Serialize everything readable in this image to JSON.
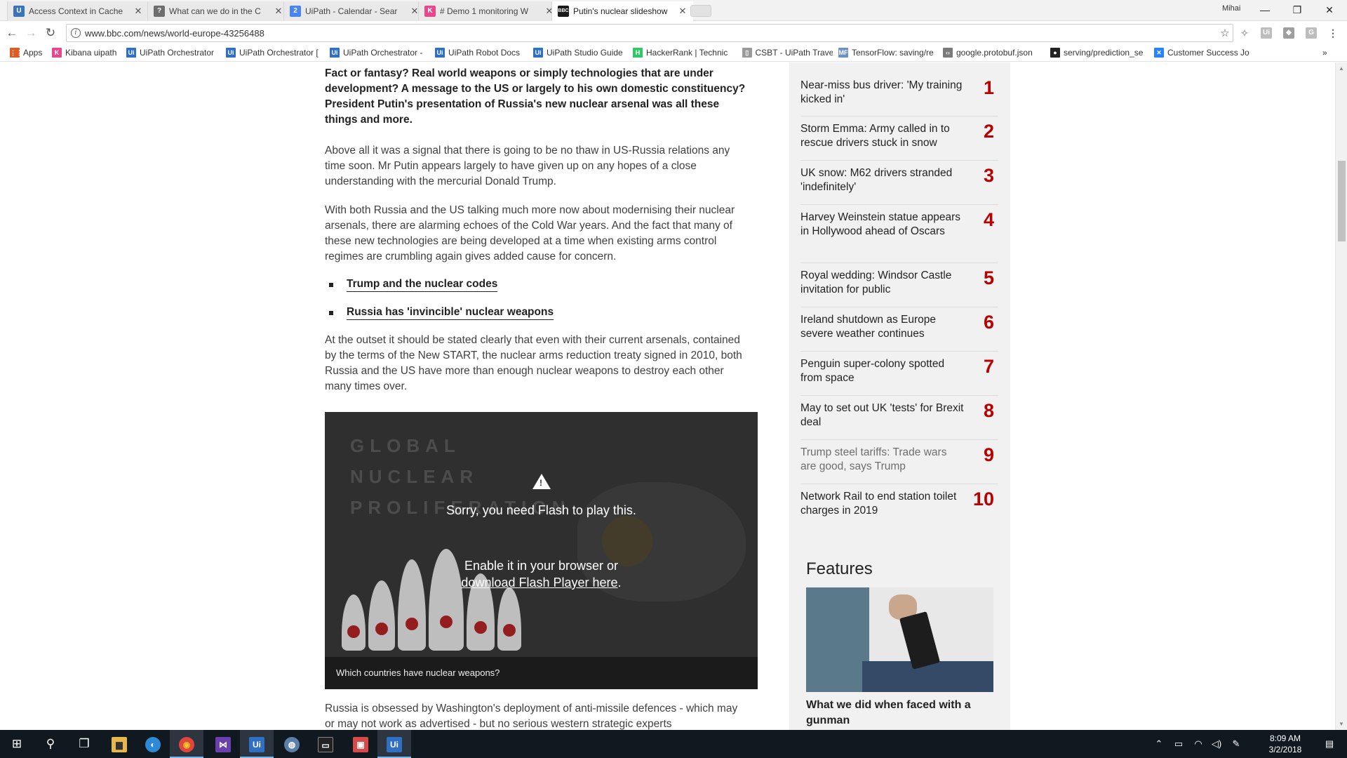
{
  "browser": {
    "tabs": [
      {
        "title": "Access Context in Cache",
        "icon": "uipath-icon",
        "color": "#3b73b9",
        "glyph": "U"
      },
      {
        "title": "What can we do in the C",
        "icon": "forum-icon",
        "color": "#6d6d6d",
        "glyph": "?"
      },
      {
        "title": "UiPath - Calendar - Sear",
        "icon": "calendar-icon",
        "color": "#4a84f0",
        "glyph": "2"
      },
      {
        "title": "# Demo 1 monitoring W",
        "icon": "kibana-icon",
        "color": "#e8488b",
        "glyph": "K"
      },
      {
        "title": "Putin's nuclear slideshow",
        "icon": "bbc-icon",
        "color": "#1a1a1a",
        "glyph": "B"
      }
    ],
    "window_user": "Mihai",
    "url": "www.bbc.com/news/world-europe-43256488",
    "bookmarks": [
      {
        "label": "Apps",
        "icon": "apps-grid-icon",
        "color": "#e05a24",
        "glyph": "⋮⋮"
      },
      {
        "label": "Kibana uipath",
        "icon": "kibana-icon",
        "color": "#e8488b",
        "glyph": "K"
      },
      {
        "label": "UiPath Orchestrator",
        "icon": "uipath-icon",
        "color": "#2f6fc4",
        "glyph": "Ui"
      },
      {
        "label": "UiPath Orchestrator [",
        "icon": "uipath-icon",
        "color": "#2f6fc4",
        "glyph": "Ui"
      },
      {
        "label": "UiPath Orchestrator -",
        "icon": "uipath-icon",
        "color": "#2f6fc4",
        "glyph": "Ui"
      },
      {
        "label": "UiPath Robot Docs",
        "icon": "uipath-icon",
        "color": "#2f6fc4",
        "glyph": "Ui"
      },
      {
        "label": "UiPath Studio Guide",
        "icon": "uipath-icon",
        "color": "#2f6fc4",
        "glyph": "Ui"
      },
      {
        "label": "HackerRank | Technic",
        "icon": "hackerrank-icon",
        "color": "#2ec866",
        "glyph": "H"
      },
      {
        "label": "CSBT - UiPath Travel",
        "icon": "page-icon",
        "color": "#9a9a9a",
        "glyph": "▯"
      },
      {
        "label": "TensorFlow: saving/re",
        "icon": "tensorflow-icon",
        "color": "#6b8fc9",
        "glyph": "MF"
      },
      {
        "label": "google.protobuf.json",
        "icon": "code-icon",
        "color": "#7a7a7a",
        "glyph": "‹›"
      },
      {
        "label": "serving/prediction_se",
        "icon": "github-icon",
        "color": "#222222",
        "glyph": "●"
      },
      {
        "label": "Customer Success Jo",
        "icon": "jira-icon",
        "color": "#2684ff",
        "glyph": "✕"
      }
    ]
  },
  "article": {
    "lead": "Fact or fantasy? Real world weapons or simply technologies that are under development? A message to the US or largely to his own domestic constituency? President Putin's presentation of Russia's new nuclear arsenal was all these things and more.",
    "para1": "Above all it was a signal that there is going to be no thaw in US-Russia relations any time soon. Mr Putin appears largely to have given up on any hopes of a close understanding with the mercurial Donald Trump.",
    "para2": "With both Russia and the US talking much more now about modernising their nuclear arsenals, there are alarming echoes of the Cold War years. And the fact that many of these new technologies are being developed at a time when existing arms control regimes are crumbling again gives added cause for concern.",
    "links": [
      "Trump and the nuclear codes",
      "Russia has 'invincible' nuclear weapons"
    ],
    "para3": "At the outset it should be stated clearly that even with their current arsenals, contained by the terms of the New START, the nuclear arms reduction treaty signed in 2010, both Russia and the US have more than enough nuclear weapons to destroy each other many times over.",
    "media": {
      "bg_title": [
        "GLOBAL",
        "NUCLEAR",
        "PROLIFERATION"
      ],
      "flash_msg": "Sorry, you need Flash to play this.",
      "enable_prefix": "Enable it in your browser or",
      "download_link": "download Flash Player here",
      "enable_suffix": ".",
      "caption": "Which countries have nuclear weapons?"
    },
    "para4": "Russia is obsessed by Washington's deployment of anti-missile defences - which may or may not work as advertised - but no serious western strategic experts"
  },
  "most_read": {
    "items": [
      {
        "rank": "1",
        "title": "Near-miss bus driver: 'My training kicked in'"
      },
      {
        "rank": "2",
        "title": "Storm Emma: Army called in to rescue drivers stuck in snow"
      },
      {
        "rank": "3",
        "title": "UK snow: M62 drivers stranded 'indefinitely'"
      },
      {
        "rank": "4",
        "title": "Harvey Weinstein statue appears in Hollywood ahead of Oscars"
      },
      {
        "rank": "5",
        "title": "Royal wedding: Windsor Castle invitation for public"
      },
      {
        "rank": "6",
        "title": "Ireland shutdown as Europe severe weather continues"
      },
      {
        "rank": "7",
        "title": "Penguin super-colony spotted from space"
      },
      {
        "rank": "8",
        "title": "May to set out UK 'tests' for Brexit deal"
      },
      {
        "rank": "9",
        "title": "Trump steel tariffs: Trade wars are good, says Trump"
      },
      {
        "rank": "10",
        "title": "Network Rail to end station toilet charges in 2019"
      }
    ],
    "rank_color": "#b80000"
  },
  "features": {
    "heading": "Features",
    "caption": "What we did when faced with a gunman"
  },
  "taskbar": {
    "time": "8:09 AM",
    "date": "3/2/2018",
    "apps": [
      {
        "name": "start-icon",
        "glyph": "⊞"
      },
      {
        "name": "search-icon",
        "glyph": "⚲"
      },
      {
        "name": "task-view-icon",
        "glyph": "❐"
      },
      {
        "name": "file-explorer-icon",
        "glyph": "▆"
      },
      {
        "name": "edge-browser-icon",
        "glyph": "◐"
      },
      {
        "name": "chrome-icon",
        "glyph": "◉"
      },
      {
        "name": "visual-studio-icon",
        "glyph": "⋈"
      },
      {
        "name": "uipath-studio-icon",
        "glyph": "Ui"
      },
      {
        "name": "network-app-icon",
        "glyph": "◍"
      },
      {
        "name": "terminal-icon",
        "glyph": "▭"
      },
      {
        "name": "paint-icon",
        "glyph": "▣"
      },
      {
        "name": "uipath-robot-icon",
        "glyph": "Ui"
      }
    ]
  }
}
